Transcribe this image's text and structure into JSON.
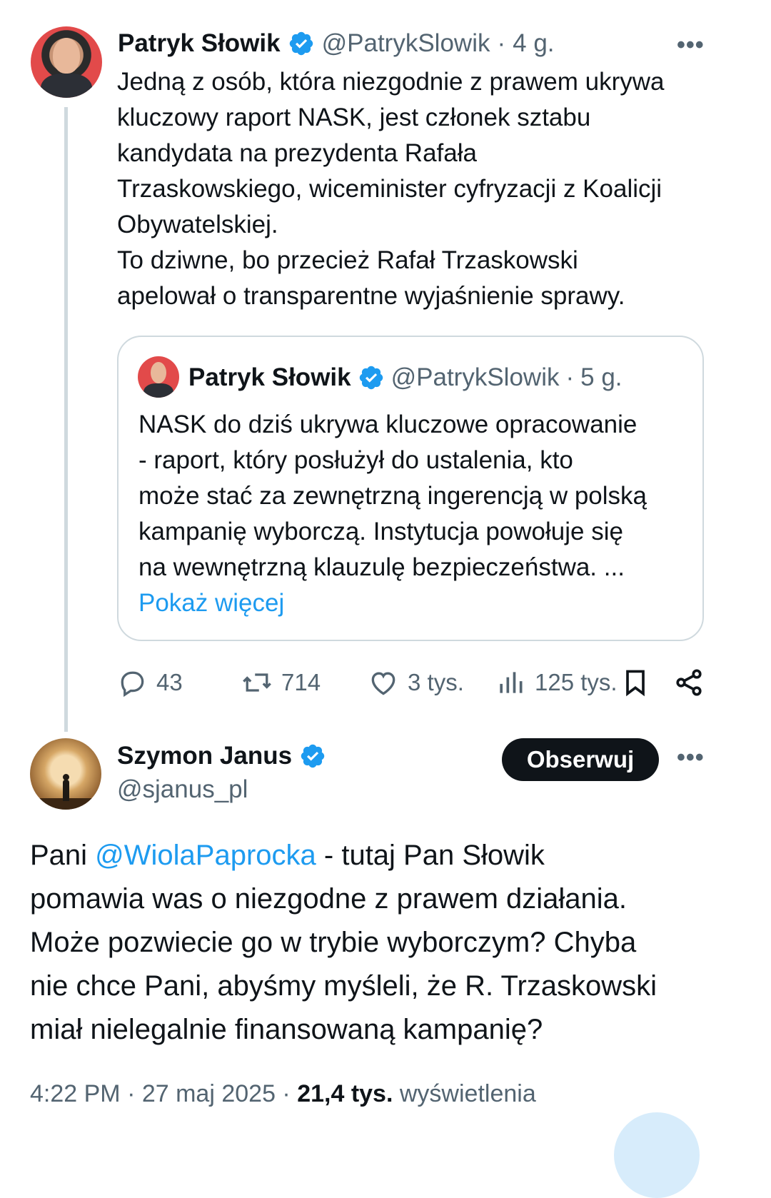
{
  "tweet1": {
    "author_name": "Patryk Słowik",
    "handle": "@PatrykSlowik",
    "time": "4 g.",
    "more": "•••",
    "text_lines": [
      "Jedną z osób, która niezgodnie z prawem ukrywa",
      "kluczowy raport NASK, jest członek sztabu",
      "kandydata na prezydenta Rafała",
      "Trzaskowskiego, wiceminister cyfryzacji z Koalicji",
      "Obywatelskiej.",
      "To dziwne, bo przecież Rafał Trzaskowski",
      "apelował o transparentne wyjaśnienie sprawy."
    ],
    "quote": {
      "author_name": "Patryk Słowik",
      "handle": "@PatrykSlowik",
      "time": "5 g.",
      "text_lines": [
        "NASK do dziś ukrywa kluczowe opracowanie",
        "- raport, który posłużył do ustalenia, kto",
        "może stać za zewnętrzną ingerencją w polską",
        "kampanię wyborczą. Instytucja powołuje się",
        "na wewnętrzną klauzulę bezpieczeństwa. ..."
      ],
      "show_more": "Pokaż więcej"
    },
    "actions": {
      "replies": "43",
      "reposts": "714",
      "likes": "3 tys.",
      "views": "125 tys."
    }
  },
  "tweet2": {
    "author_name": "Szymon Janus",
    "handle": "@sjanus_pl",
    "follow_label": "Obserwuj",
    "more": "•••",
    "text": {
      "prefix": "Pani ",
      "mention": "@WiolaPaprocka",
      "line1_rest": " - tutaj Pan Słowik",
      "lines": [
        "pomawia was o niezgodne z prawem działania.",
        "Może pozwiecie go w trybie wyborczym? Chyba",
        "nie chce Pani, abyśmy myśleli, że R. Trzaskowski",
        "miał nielegalnie finansowaną kampanię?"
      ]
    },
    "meta": {
      "time": "4:22 PM",
      "sep": " · ",
      "date": "27 maj 2025",
      "views_count": "21,4 tys.",
      "views_label": "wyświetlenia"
    }
  },
  "colors": {
    "accent": "#1d9bf0",
    "text": "#0f1419",
    "secondary": "#536471",
    "border": "#cfd9de"
  }
}
